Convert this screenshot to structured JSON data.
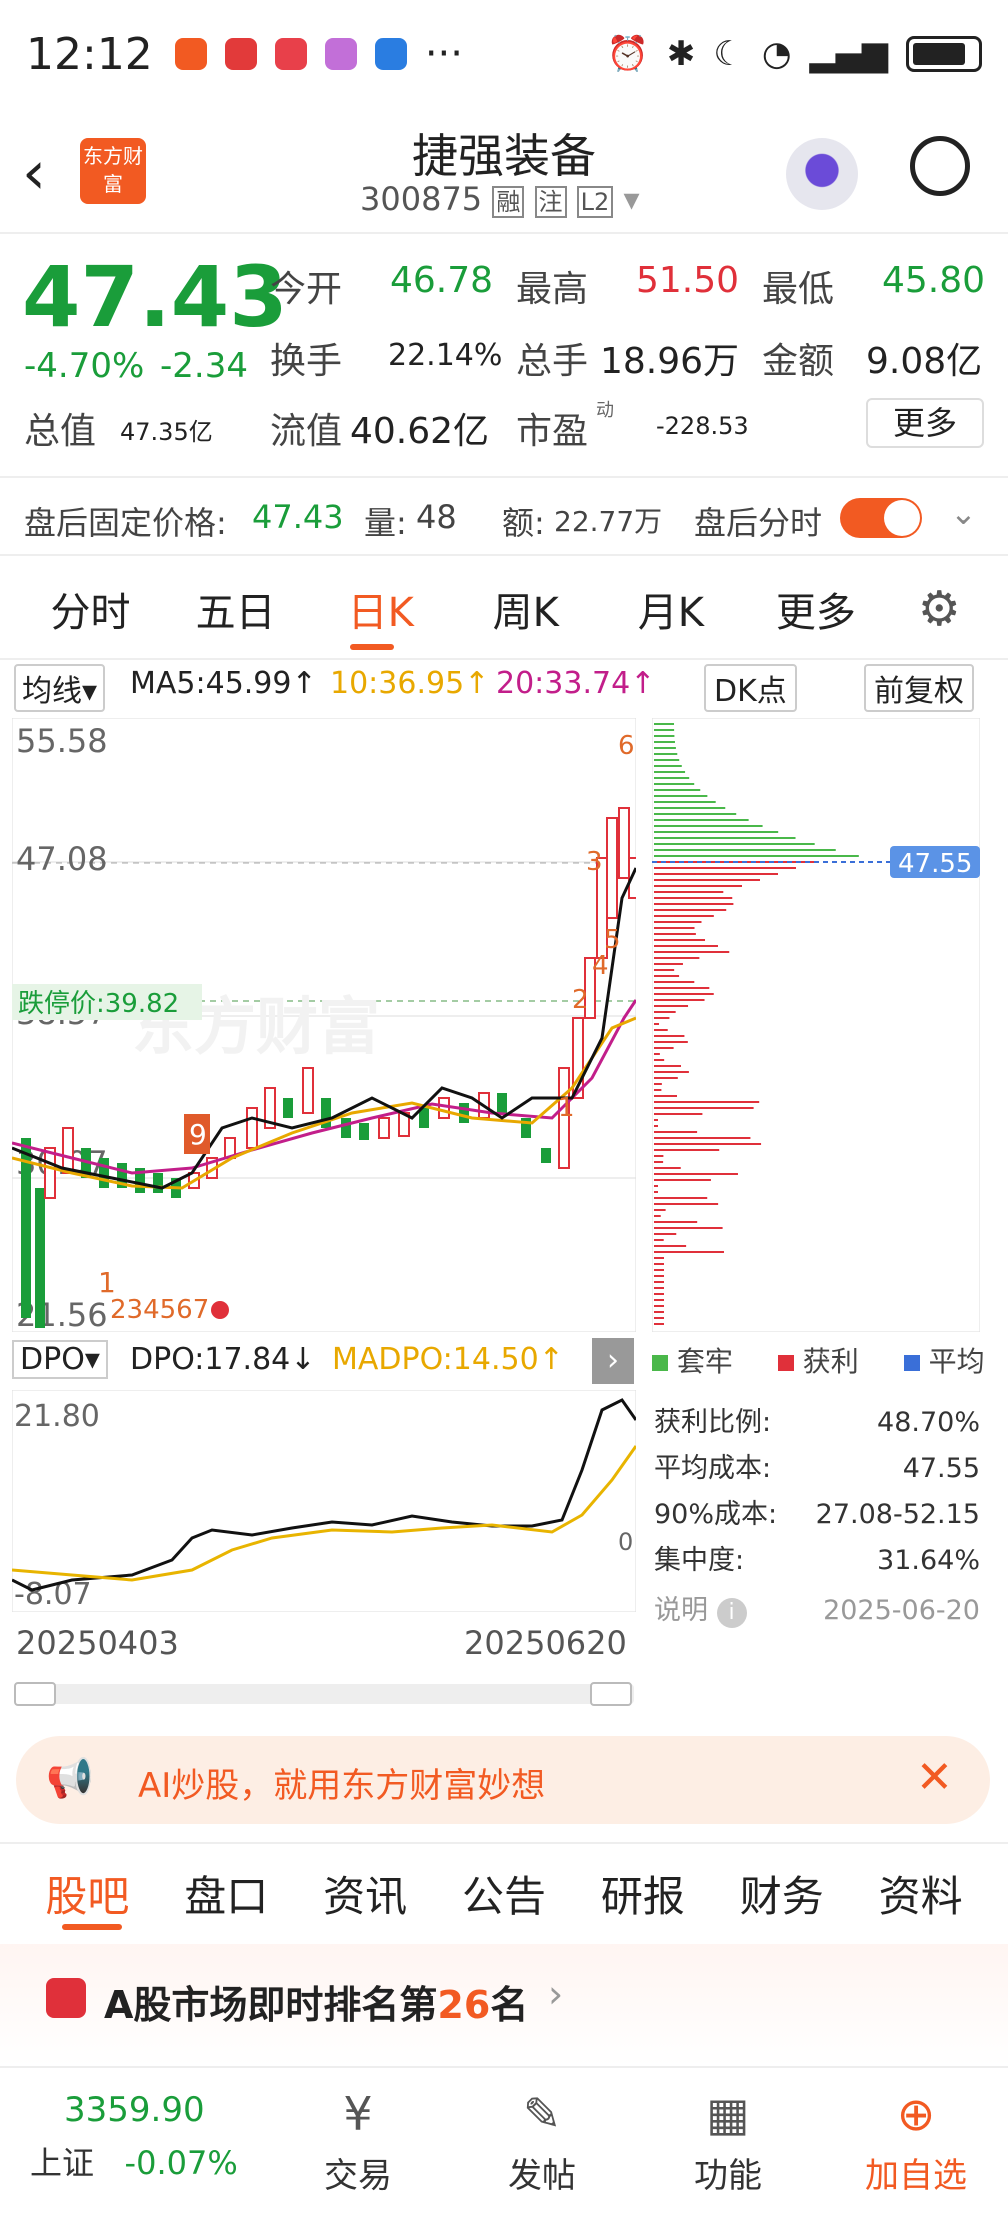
{
  "status_bar": {
    "time": "12:12",
    "more": "···"
  },
  "header": {
    "title": "捷强装备",
    "code": "300875",
    "badge1": "融",
    "badge2": "注",
    "badge3": "L2",
    "logo_text": "东方财富"
  },
  "quote": {
    "price": "47.43",
    "pct": "-4.70%",
    "chg": "-2.34",
    "open_label": "今开",
    "open": "46.78",
    "high_label": "最高",
    "high": "51.50",
    "low_label": "最低",
    "low": "45.80",
    "turnover_label": "换手",
    "turnover": "22.14%",
    "vol_label": "总手",
    "vol": "18.96万",
    "amount_label": "金额",
    "amount": "9.08亿",
    "mcap_label": "总值",
    "mcap": "47.35亿",
    "float_label": "流值",
    "float": "40.62亿",
    "pe_label": "市盈",
    "pe_sup": "动",
    "pe": "-228.53",
    "more": "更多"
  },
  "after_hours": {
    "price_label": "盘后固定价格:",
    "price": "47.43",
    "vol_label": "量:",
    "vol": "48",
    "amt_label": "额:",
    "amt": "22.77万",
    "toggle_label": "盘后分时"
  },
  "chart_tabs": [
    "分时",
    "五日",
    "日K",
    "周K",
    "月K",
    "更多"
  ],
  "ma_row": {
    "ma_sel": "均线",
    "ma5": "MA5:45.99↑",
    "ma10": "10:36.95↑",
    "ma20": "20:33.74↑",
    "dk": "DK点",
    "fq": "前复权"
  },
  "kchart": {
    "y_labels": [
      "55.58",
      "47.08",
      "38.57",
      "30.07",
      "21.56"
    ],
    "limit_down": "跌停价:39.82",
    "watermark": "东方财富",
    "cost_tag": "47.55",
    "tags": [
      "6",
      "3",
      "5",
      "4",
      "2",
      "1",
      "9",
      "1",
      "234567"
    ]
  },
  "dpo": {
    "sel": "DPO",
    "dpo": "DPO:17.84↓",
    "madpo": "MADPO:14.50↑",
    "ytop": "21.80",
    "ybot": "-8.07",
    "zero": "0",
    "x_start": "20250403",
    "x_end": "20250620"
  },
  "chip": {
    "legend": [
      "套牢",
      "获利",
      "平均"
    ],
    "rows": [
      [
        "获利比例:",
        "48.70%"
      ],
      [
        "平均成本:",
        "47.55"
      ],
      [
        "90%成本:",
        "27.08-52.15"
      ],
      [
        "集中度:",
        "31.64%"
      ]
    ],
    "note": "说明",
    "date": "2025-06-20"
  },
  "ad": {
    "text": "AI炒股，就用东方财富妙想"
  },
  "sub_tabs": [
    "股吧",
    "盘口",
    "资讯",
    "公告",
    "研报",
    "财务",
    "资料"
  ],
  "rank": {
    "prefix": "A股市场即时排名第",
    "num": "26",
    "suffix": "名"
  },
  "bottom": {
    "index_val": "3359.90",
    "index_name": "上证",
    "index_chg": "-0.07%",
    "items": [
      "交易",
      "发帖",
      "功能",
      "加自选"
    ]
  },
  "chart_data": {
    "type": "candlestick",
    "ylim": [
      21.56,
      55.58
    ],
    "x_start": "20250403",
    "x_end": "20250620",
    "last_close": 47.43,
    "ma5": 45.99,
    "ma10": 36.95,
    "ma20": 33.74
  }
}
